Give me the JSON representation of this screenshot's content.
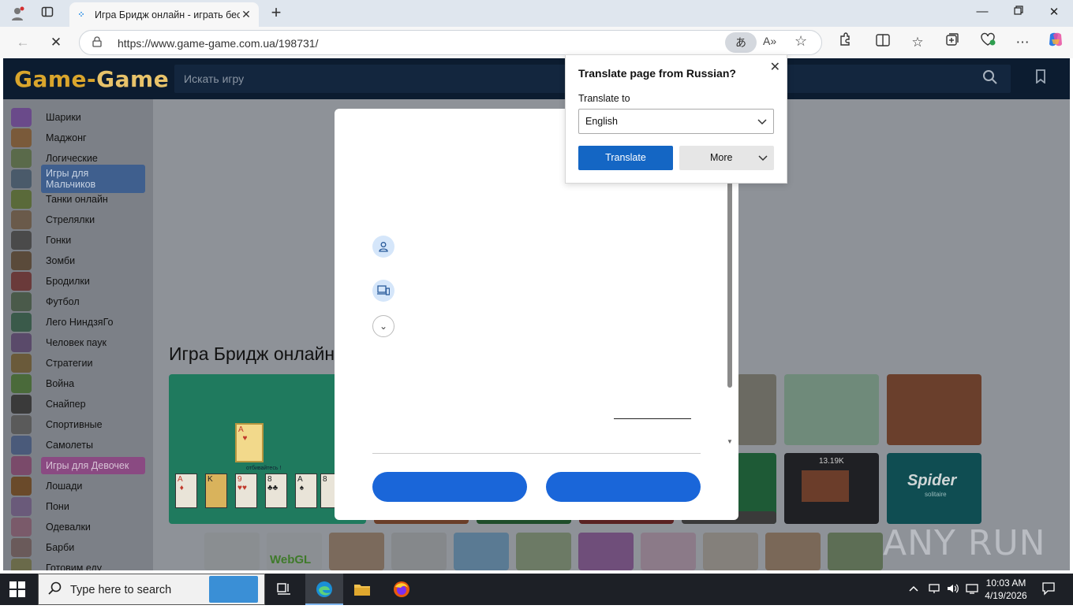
{
  "browser": {
    "tab_title": "Игра Бридж онлайн - играть бес",
    "url": "https://www.game-game.com.ua/198731/",
    "new_tab": "+",
    "window_controls": [
      "minimize-icon",
      "restore-icon",
      "close-icon"
    ]
  },
  "site": {
    "logo_part1": "Game-",
    "logo_part2": "Game",
    "search_placeholder": "Искать игру",
    "page_title": "Игра Бридж онлайн",
    "categories": [
      {
        "label": "Шарики",
        "highlight": ""
      },
      {
        "label": "Маджонг",
        "highlight": ""
      },
      {
        "label": "Логические",
        "highlight": ""
      },
      {
        "label": "Игры для Мальчиков",
        "highlight": "boys"
      },
      {
        "label": "Танки онлайн",
        "highlight": ""
      },
      {
        "label": "Стрелялки",
        "highlight": ""
      },
      {
        "label": "Гонки",
        "highlight": ""
      },
      {
        "label": "Зомби",
        "highlight": ""
      },
      {
        "label": "Бродилки",
        "highlight": ""
      },
      {
        "label": "Футбол",
        "highlight": ""
      },
      {
        "label": "Лего НиндзяГо",
        "highlight": ""
      },
      {
        "label": "Человек паук",
        "highlight": ""
      },
      {
        "label": "Стратегии",
        "highlight": ""
      },
      {
        "label": "Война",
        "highlight": ""
      },
      {
        "label": "Снайпер",
        "highlight": ""
      },
      {
        "label": "Спортивные",
        "highlight": ""
      },
      {
        "label": "Самолеты",
        "highlight": ""
      },
      {
        "label": "Игры для Девочек",
        "highlight": "girls"
      },
      {
        "label": "Лошади",
        "highlight": ""
      },
      {
        "label": "Пони",
        "highlight": ""
      },
      {
        "label": "Одевалки",
        "highlight": ""
      },
      {
        "label": "Барби",
        "highlight": ""
      },
      {
        "label": "Готовим еду",
        "highlight": ""
      }
    ],
    "thumb_texts": {
      "score": "13.19K",
      "spider": "Spider",
      "spider_sub": "solitaire",
      "webgl": "WebGL",
      "card_hint": "отбивайтесь !"
    },
    "watermark": "ANY RUN"
  },
  "translate_popup": {
    "title": "Translate page from Russian?",
    "label": "Translate to",
    "selected_language": "English",
    "translate_button": "Translate",
    "more_button": "More"
  },
  "taskbar": {
    "search_placeholder": "Type here to search",
    "time": "10:03 AM",
    "date": "4/19/2026"
  },
  "colors": {
    "accent_blue": "#1a66d9",
    "translate_blue": "#1466c4",
    "site_header": "#0c1c30",
    "logo_gold": "#d9a52c"
  }
}
